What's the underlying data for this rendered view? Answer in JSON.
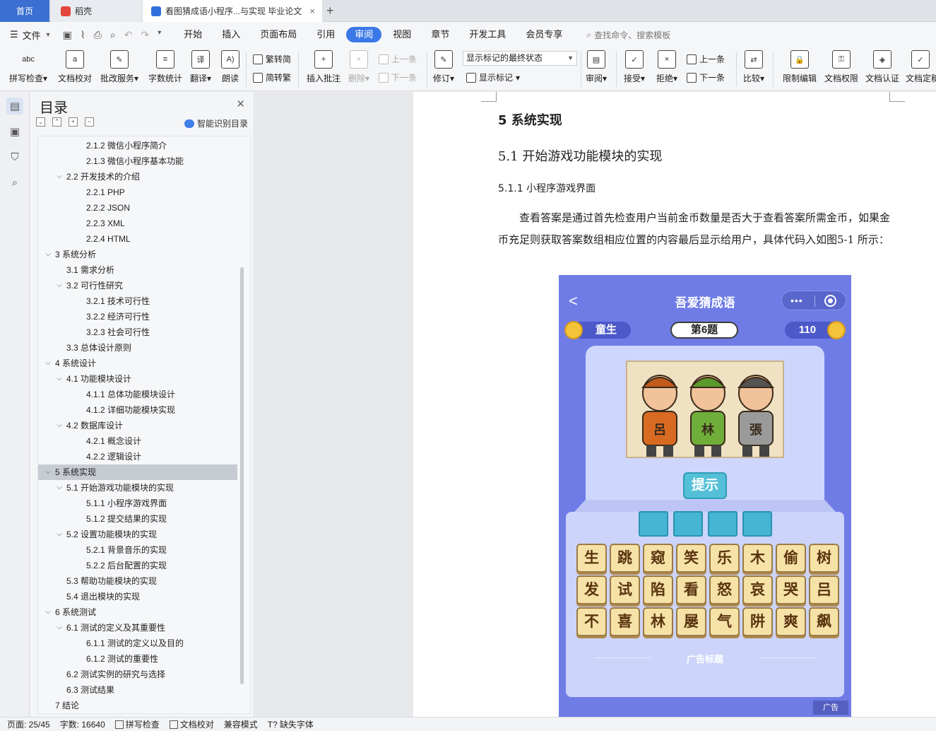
{
  "tabs": {
    "home": "首页",
    "daoke": "稻壳",
    "document": "看图猜成语小程序...与实现 毕业论文",
    "close": "×",
    "add": "+"
  },
  "menu": {
    "file": "文件",
    "tabs": [
      "开始",
      "插入",
      "页面布局",
      "引用",
      "审阅",
      "视图",
      "章节",
      "开发工具",
      "会员专享"
    ],
    "active_tab": "审阅",
    "search_placeholder": "查找命令、搜索模板"
  },
  "ribbon": {
    "spell_check": "拼写检查",
    "doc_proof": "文档校对",
    "review_service": "批改服务",
    "word_count": "字数统计",
    "translate": "翻译",
    "read_aloud": "朗读",
    "to_traditional": "繁转简",
    "to_simplified": "简转繁",
    "insert_comment": "插入批注",
    "delete": "删除",
    "prev_comment": "上一条",
    "next_comment": "下一条",
    "track_changes": "修订",
    "markup_state": "显示标记的最终状态",
    "show_markup": "显示标记",
    "review_pane": "审阅",
    "accept": "接受",
    "reject": "拒绝",
    "prev_change": "上一条",
    "next_change": "下一条",
    "compare": "比较",
    "restrict_edit": "限制编辑",
    "doc_permission": "文档权限",
    "doc_certify": "文档认证",
    "doc_final": "文档定稿",
    "abc": "abc"
  },
  "toc": {
    "title": "目录",
    "smart_toc": "智能识别目录",
    "items": [
      {
        "label": "2.1.2 微信小程序简介",
        "level": 3,
        "caret": ""
      },
      {
        "label": "2.1.3 微信小程序基本功能",
        "level": 3,
        "caret": ""
      },
      {
        "label": "2.2 开发技术的介绍",
        "level": 2,
        "caret": "v"
      },
      {
        "label": "2.2.1 PHP",
        "level": 3,
        "caret": ""
      },
      {
        "label": "2.2.2 JSON",
        "level": 3,
        "caret": ""
      },
      {
        "label": "2.2.3 XML",
        "level": 3,
        "caret": ""
      },
      {
        "label": "2.2.4 HTML",
        "level": 3,
        "caret": ""
      },
      {
        "label": "3  系统分析",
        "level": 1,
        "caret": "v"
      },
      {
        "label": "3.1  需求分析",
        "level": 2,
        "caret": ""
      },
      {
        "label": "3.2  可行性研究",
        "level": 2,
        "caret": "v"
      },
      {
        "label": "3.2.1  技术可行性",
        "level": 3,
        "caret": ""
      },
      {
        "label": "3.2.2  经济可行性",
        "level": 3,
        "caret": ""
      },
      {
        "label": "3.2.3  社会可行性",
        "level": 3,
        "caret": ""
      },
      {
        "label": "3.3  总体设计原则",
        "level": 2,
        "caret": ""
      },
      {
        "label": "4  系统设计",
        "level": 1,
        "caret": "v"
      },
      {
        "label": "4.1  功能模块设计",
        "level": 2,
        "caret": "v"
      },
      {
        "label": "4.1.1  总体功能模块设计",
        "level": 3,
        "caret": ""
      },
      {
        "label": "4.1.2  详细功能模块实现",
        "level": 3,
        "caret": ""
      },
      {
        "label": "4.2  数据库设计",
        "level": 2,
        "caret": "v"
      },
      {
        "label": "4.2.1  概念设计",
        "level": 3,
        "caret": ""
      },
      {
        "label": "4.2.2  逻辑设计",
        "level": 3,
        "caret": ""
      },
      {
        "label": "5  系统实现",
        "level": 1,
        "caret": "v",
        "active": true
      },
      {
        "label": "5.1  开始游戏功能模块的实现",
        "level": 2,
        "caret": "v"
      },
      {
        "label": "5.1.1 小程序游戏界面",
        "level": 3,
        "caret": ""
      },
      {
        "label": "5.1.2  提交结果的实现",
        "level": 3,
        "caret": ""
      },
      {
        "label": "5.2  设置功能模块的实现",
        "level": 2,
        "caret": "v"
      },
      {
        "label": "5.2.1  背景音乐的实现",
        "level": 3,
        "caret": ""
      },
      {
        "label": "5.2.2  后台配置的实现",
        "level": 3,
        "caret": ""
      },
      {
        "label": "5.3 帮助功能模块的实现",
        "level": 2,
        "caret": ""
      },
      {
        "label": "5.4 退出模块的实现",
        "level": 2,
        "caret": ""
      },
      {
        "label": "6  系统测试",
        "level": 1,
        "caret": "v"
      },
      {
        "label": "6.1  测试的定义及其重要性",
        "level": 2,
        "caret": "v"
      },
      {
        "label": "6.1.1  测试的定义以及目的",
        "level": 3,
        "caret": ""
      },
      {
        "label": "6.1.2  测试的重要性",
        "level": 3,
        "caret": ""
      },
      {
        "label": "6.2  测试实例的研究与选择",
        "level": 2,
        "caret": ""
      },
      {
        "label": "6.3  测试结果",
        "level": 2,
        "caret": ""
      },
      {
        "label": "7  结论",
        "level": 1,
        "caret": ""
      }
    ]
  },
  "document": {
    "h1": "5  系统实现",
    "h2": "5.1  开始游戏功能模块的实现",
    "h3": "5.1.1 小程序游戏界面",
    "paragraph": "查看答案是通过首先检查用户当前金币数量是否大于查看答案所需金币，如果金币充足则获取答案数组相应位置的内容最后显示给用户，具体代码入如图5-1 所示："
  },
  "phone": {
    "back": "<",
    "title": "吾爱猜成语",
    "menu_dots": "•••",
    "rank": "童生",
    "level": "第6题",
    "coins": "110",
    "picture_chars": [
      "呂",
      "林",
      "張"
    ],
    "hint": "提示",
    "tiles": [
      [
        "生",
        "跳",
        "窥",
        "笑",
        "乐",
        "木",
        "偷",
        "树"
      ],
      [
        "发",
        "试",
        "陷",
        "看",
        "怒",
        "哀",
        "哭",
        "吕"
      ],
      [
        "不",
        "喜",
        "林",
        "屡",
        "气",
        "阱",
        "爽",
        "飙"
      ]
    ],
    "ad_title": "广告标题",
    "ad_tag": "广告"
  },
  "status": {
    "page": "页面: 25/45",
    "words": "字数: 16640",
    "spell": "拼写检查",
    "proof": "文档校对",
    "compat": "兼容模式",
    "missing_font": "缺失字体"
  },
  "colors": {
    "accent": "#3b78e7",
    "phone_bg": "#6f7ce6",
    "tile": "#f6e2a6",
    "slot": "#46b4d3"
  }
}
